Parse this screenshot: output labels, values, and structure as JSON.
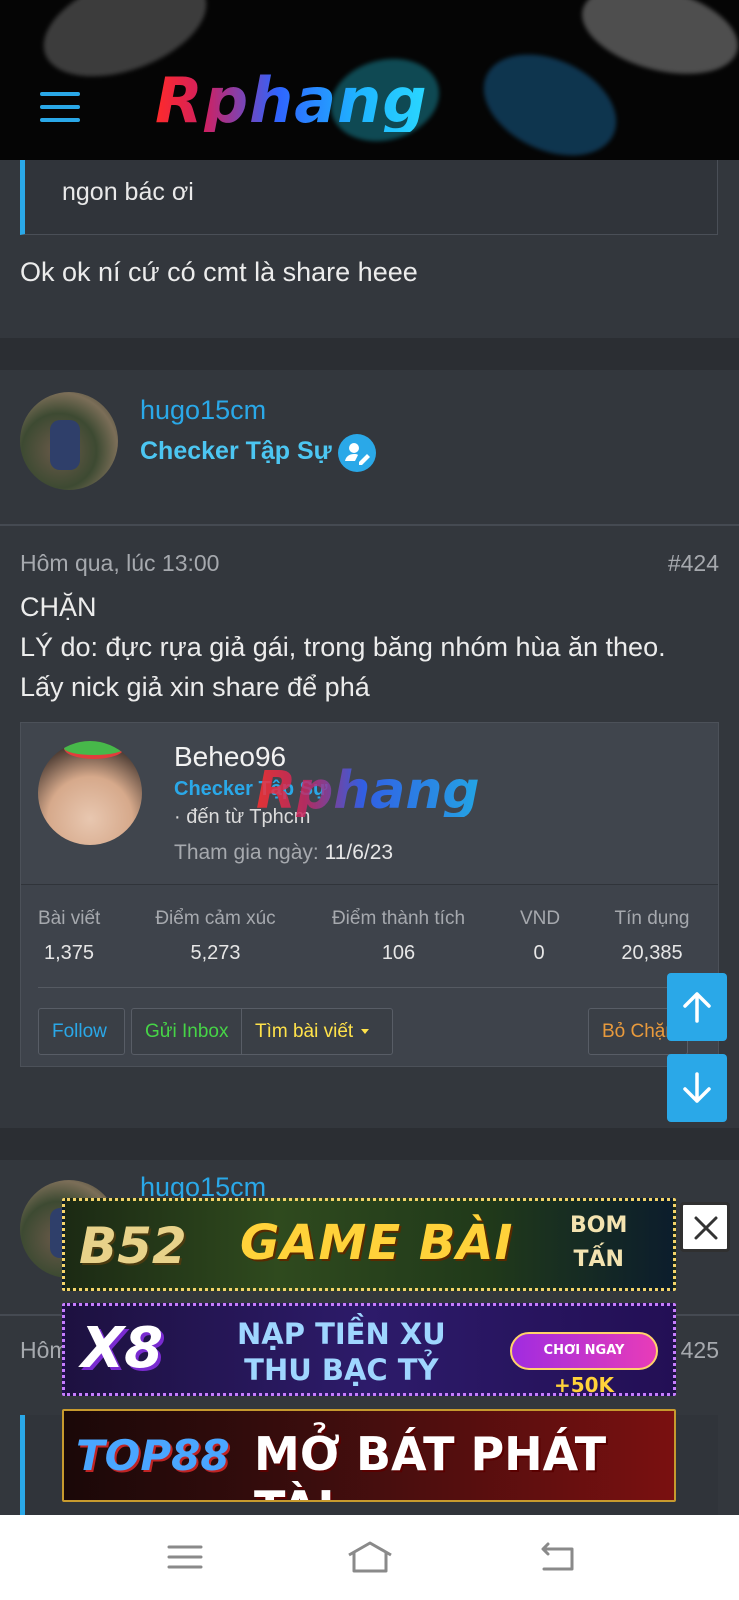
{
  "header": {
    "logo_text": "Rphang",
    "menu_icon": "hamburger-icon"
  },
  "post_prev": {
    "quote_text": "ngon bác ơi",
    "message": "Ok ok ní cứ có cmt là share heee"
  },
  "post_main": {
    "username": "hugo15cm",
    "role": "Checker Tập Sự",
    "role_icon": "user-edit-icon",
    "date": "Hôm qua, lúc 13:00",
    "number": "#424",
    "lines": [
      "CHẶN",
      "LÝ do: đực rựa giả gái, trong băng nhóm hùa ăn theo.",
      "Lấy nick giả xin share để phá"
    ],
    "profile_card": {
      "name": "Beheo96",
      "role": "Checker Tập Sự",
      "from": "· đến từ Tphcm",
      "join_label": "Tham gia ngày:",
      "join_date": "11/6/23",
      "watermark": "Rphang",
      "stats": [
        {
          "label": "Bài viết",
          "value": "1,375"
        },
        {
          "label": "Điểm cảm xúc",
          "value": "5,273"
        },
        {
          "label": "Điểm thành tích",
          "value": "106"
        },
        {
          "label": "VND",
          "value": "0"
        },
        {
          "label": "Tín dụng",
          "value": "20,385"
        }
      ],
      "buttons": {
        "follow": "Follow",
        "inbox": "Gửi Inbox",
        "find": "Tìm bài viết",
        "block": "Bỏ Chặn"
      }
    }
  },
  "post_next": {
    "username": "hugo15cm",
    "date": "Hôm",
    "number": "425"
  },
  "ads": [
    {
      "brand": "B52",
      "text": "GAME BÀI",
      "side_1": "BOM",
      "side_2": "TẤN"
    },
    {
      "brand": "X8",
      "line_1": "NẠP TIỀN XU",
      "line_2": "THU BẠC TỶ",
      "pill_label": "CHƠI NGAY",
      "pill_bonus": "+50K"
    },
    {
      "brand": "TOP88",
      "text": "MỞ BÁT PHÁT TÀI"
    }
  ],
  "colors": {
    "accent": "#2aa8e8",
    "background": "#2b2e33",
    "card": "#33373d"
  }
}
